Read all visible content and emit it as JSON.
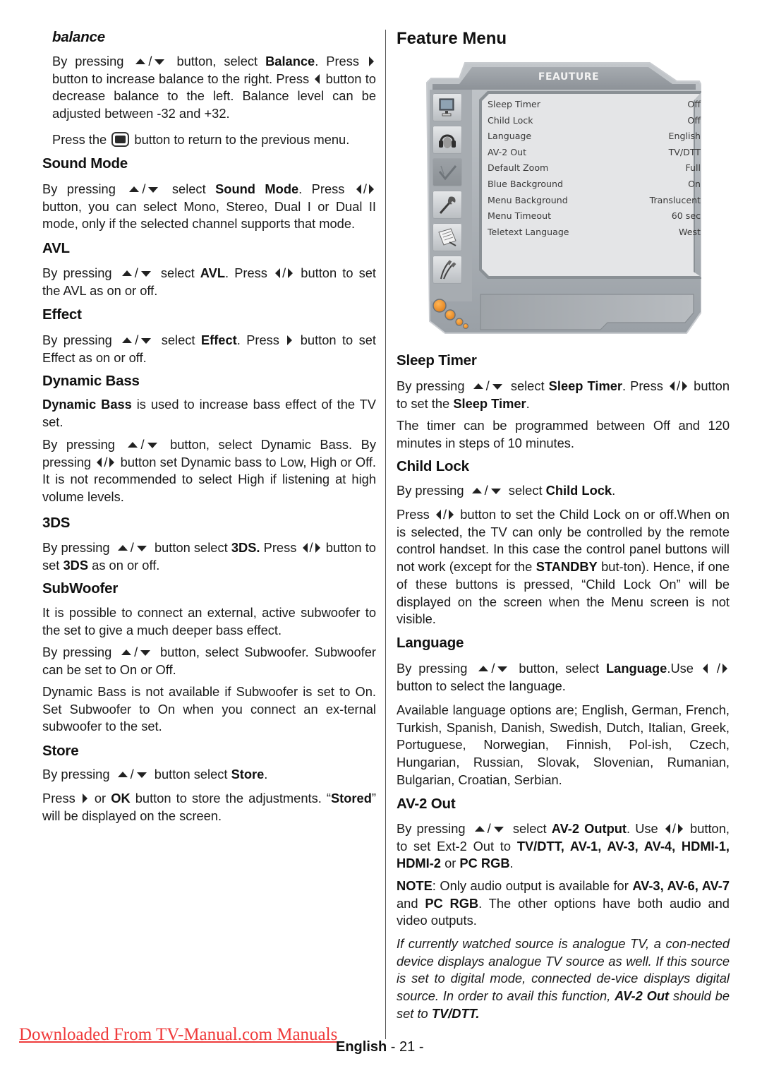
{
  "left_column": {
    "balance": {
      "heading": "balance",
      "p1_a": "By pressing",
      "p1_b": "button, select",
      "p1_bold": "Balance",
      "p1_c": ". Press",
      "p1_d": "button to increase balance to the right. Press",
      "p1_e": "button to decrease balance to the left. Balance level can be adjusted between -32 and +32.",
      "p2_a": "Press the",
      "p2_b": "button to return to the previous menu."
    },
    "sound_mode": {
      "heading": "Sound Mode",
      "p1_a": "By pressing",
      "p1_b": "select",
      "p1_bold": "Sound Mode",
      "p1_c": ". Press",
      "p1_d": "button, you can select Mono, Stereo, Dual I or Dual II mode, only if the selected channel supports that mode."
    },
    "avl": {
      "heading": "AVL",
      "p1_a": "By pressing",
      "p1_b": "select",
      "p1_bold": "AVL",
      "p1_c": ". Press",
      "p1_d": "button  to set the AVL as on or off."
    },
    "effect": {
      "heading": "Effect",
      "p1_a": "By pressing",
      "p1_b": "select",
      "p1_bold": "Effect",
      "p1_c": ". Press",
      "p1_d": "button  to set Effect as on or off."
    },
    "dynamic_bass": {
      "heading": "Dynamic Bass",
      "p1_bold": "Dynamic Bass",
      "p1_a": "is used to increase bass effect of the TV set.",
      "p2_a": "By pressing",
      "p2_b": "button, select Dynamic Bass. By pressing",
      "p2_c": "button set Dynamic bass to Low, High or Off. It is not recommended to select High if listening at high volume levels."
    },
    "three_ds": {
      "heading": "3DS",
      "p1_a": "By pressing",
      "p1_b": "button select",
      "p1_bold": "3DS.",
      "p1_c": "Press",
      "p1_d": "button  to set",
      "p1_bold2": "3DS",
      "p1_e": "as on or off."
    },
    "subwoofer": {
      "heading": "SubWoofer",
      "p1": "It is possible to connect an external, active subwoofer to the set to give a much deeper bass effect.",
      "p2_a": "By pressing",
      "p2_b": "button, select Subwoofer. Subwoofer can be set to On or Off.",
      "p3": "Dynamic Bass is not available if Subwoofer is set to On. Set Subwoofer to On when you connect an ex-ternal subwoofer to the set."
    },
    "store": {
      "heading": "Store",
      "p1_a": "By pressing",
      "p1_b": "button  select",
      "p1_bold": "Store",
      "p1_c": ".",
      "p2_a": "Press",
      "p2_b": "or",
      "p2_bold": "OK",
      "p2_c": "button to store the adjustments. “",
      "p2_bold2": "Stored",
      "p2_d": "” will be displayed on the screen."
    }
  },
  "right_column": {
    "title": "Feature Menu",
    "menu_screen": {
      "title": "FEAUTURE",
      "accent_color": "#f39a2e",
      "side_icons": [
        "picture-icon",
        "sound-icon",
        "feature-icon",
        "install-icon",
        "source-list-icon",
        "connection-icon"
      ],
      "selected_icon": "feature-icon",
      "rows": [
        {
          "label": "Sleep Timer",
          "value": "Off"
        },
        {
          "label": "Child Lock",
          "value": "Off"
        },
        {
          "label": "Language",
          "value": "English"
        },
        {
          "label": "AV-2 Out",
          "value": "TV/DTT"
        },
        {
          "label": "Default Zoom",
          "value": "Full"
        },
        {
          "label": "Blue Background",
          "value": "On"
        },
        {
          "label": "Menu Background",
          "value": "Translucent"
        },
        {
          "label": "Menu Timeout",
          "value": "60 sec"
        },
        {
          "label": "Teletext Language",
          "value": "West"
        }
      ]
    },
    "sleep_timer": {
      "heading": "Sleep Timer",
      "p1_a": "By pressing",
      "p1_b": "select",
      "p1_bold": "Sleep Timer",
      "p1_c": ". Press",
      "p1_d": "button to set the",
      "p1_bold2": "Sleep Timer",
      "p1_e": ".",
      "p2": "The timer can be programmed between Off and 120 minutes in steps of 10 minutes."
    },
    "child_lock": {
      "heading": "Child Lock",
      "p1_a": "By pressing",
      "p1_b": "select",
      "p1_bold": "Child Lock",
      "p1_c": ".",
      "p2_a": "Press",
      "p2_b": "button  to set the Child Lock on or off.When on is selected, the TV can only be controlled by the remote control handset. In this case the control panel buttons will not work (except for the",
      "p2_bold": "STANDBY",
      "p2_c": "but-ton). Hence, if one of these buttons is pressed, “Child Lock On” will be displayed on the screen when the Menu screen is not visible."
    },
    "language": {
      "heading": "Language",
      "p1_a": "By pressing",
      "p1_b": "button, select",
      "p1_bold": "Language",
      "p1_c": ".Use",
      "p1_d": "/",
      "p1_e": "button to select the language.",
      "p2": "Available language options are; English, German, French, Turkish, Spanish, Danish, Swedish, Dutch, Italian, Greek, Portuguese, Norwegian, Finnish, Pol-ish, Czech, Hungarian, Russian, Slovak, Slovenian, Rumanian, Bulgarian, Croatian, Serbian."
    },
    "av2_out": {
      "heading": "AV-2 Out",
      "p1_a": "By pressing",
      "p1_b": "select",
      "p1_bold": "AV-2 Output",
      "p1_c": ". Use",
      "p1_d": "button, to set Ext-2 Out to",
      "p1_bold2": "TV/DTT, AV-1, AV-3, AV-4, HDMI-1, HDMI-2",
      "p1_e": "or",
      "p1_bold3": "PC RGB",
      "p1_f": ".",
      "p2_bold": "NOTE",
      "p2_a": ": Only audio output is available for",
      "p2_bold2": "AV-3, AV-6, AV-7",
      "p2_b": "and",
      "p2_bold3": "PC RGB",
      "p2_c": ". The other options have both audio and video outputs.",
      "p3_a": "If currently watched source is analogue TV, a con-nected device displays analogue TV source as well. If this source is set to digital mode, connected de-vice displays digital source. In order to avail this function,",
      "p3_bold": "AV-2 Out",
      "p3_b": "should be set to",
      "p3_bold2": "TV/DTT."
    }
  },
  "footer": {
    "download_link": "Downloaded From TV-Manual.com Manuals",
    "link_color": "#ef3b3b",
    "language": "English",
    "page_number": "- 21 -"
  }
}
